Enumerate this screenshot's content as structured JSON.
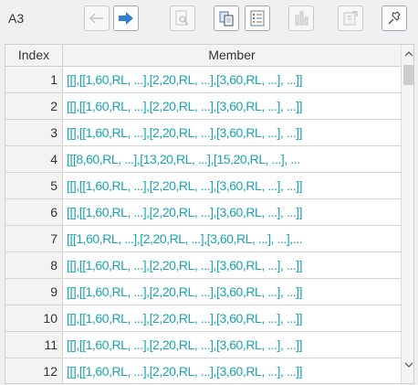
{
  "toolbar": {
    "cell_ref": "A3",
    "buttons": [
      {
        "name": "back-button",
        "icon": "arrow-left-icon",
        "enabled": false
      },
      {
        "name": "forward-button",
        "icon": "arrow-right-icon",
        "enabled": true
      },
      {
        "name": "preview-button",
        "icon": "magnifier-page-icon",
        "enabled": false
      },
      {
        "name": "copy-button",
        "icon": "copy-icon",
        "enabled": true
      },
      {
        "name": "list-view-button",
        "icon": "list-icon",
        "enabled": true
      },
      {
        "name": "chart-button",
        "icon": "bar-chart-icon",
        "enabled": false
      },
      {
        "name": "export-button",
        "icon": "export-icon",
        "enabled": false
      },
      {
        "name": "pin-button",
        "icon": "pin-icon",
        "enabled": true
      }
    ],
    "accent_color": "#2f7fd3"
  },
  "table": {
    "columns": [
      "Index",
      "Member"
    ],
    "member_color": "#1aa3b3",
    "rows": [
      {
        "index": "1",
        "member": "[[],[[1,60,RL, ...],[2,20,RL, ...],[3,60,RL, ...], ...]]"
      },
      {
        "index": "2",
        "member": "[[],[[1,60,RL, ...],[2,20,RL, ...],[3,60,RL, ...], ...]]"
      },
      {
        "index": "3",
        "member": "[[],[[1,60,RL, ...],[2,20,RL, ...],[3,60,RL, ...], ...]]"
      },
      {
        "index": "4",
        "member": "[[[8,60,RL, ...],[13,20,RL, ...],[15,20,RL, ...], ..."
      },
      {
        "index": "5",
        "member": "[[],[[1,60,RL, ...],[2,20,RL, ...],[3,60,RL, ...], ...]]"
      },
      {
        "index": "6",
        "member": "[[],[[1,60,RL, ...],[2,20,RL, ...],[3,60,RL, ...], ...]]"
      },
      {
        "index": "7",
        "member": "[[[1,60,RL, ...],[2,20,RL, ...],[3,60,RL, ...], ...],..."
      },
      {
        "index": "8",
        "member": "[[],[[1,60,RL, ...],[2,20,RL, ...],[3,60,RL, ...], ...]]"
      },
      {
        "index": "9",
        "member": "[[],[[1,60,RL, ...],[2,20,RL, ...],[3,60,RL, ...], ...]]"
      },
      {
        "index": "10",
        "member": "[[],[[1,60,RL, ...],[2,20,RL, ...],[3,60,RL, ...], ...]]"
      },
      {
        "index": "11",
        "member": "[[],[[1,60,RL, ...],[2,20,RL, ...],[3,60,RL, ...], ...]]"
      },
      {
        "index": "12",
        "member": "[[],[[1,60,RL, ...],[2,20,RL, ...],[3,60,RL, ...], ...]]"
      }
    ]
  }
}
